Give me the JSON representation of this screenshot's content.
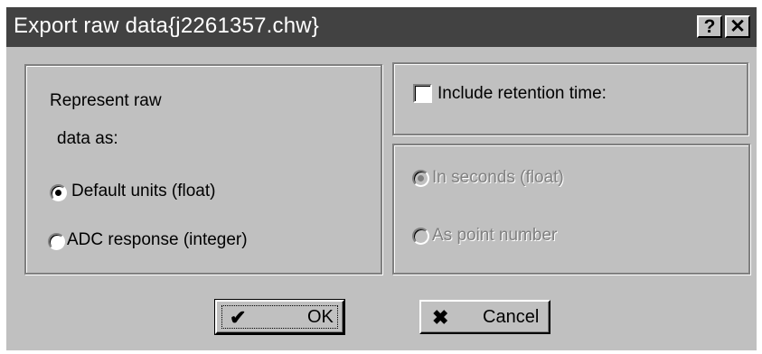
{
  "dialog": {
    "title": "Export raw data{j2261357.chw}",
    "help_button": "?",
    "close_button": "✕"
  },
  "represent": {
    "label_line1": "Represent raw",
    "label_line2": "data as:",
    "options": [
      {
        "label": "Default units (float)",
        "checked": true
      },
      {
        "label": "ADC response (integer)",
        "checked": false
      }
    ]
  },
  "retention": {
    "checkbox_label": "Include retention time:",
    "checked": false,
    "options": [
      {
        "label": "In seconds (float)",
        "checked": true,
        "enabled": false
      },
      {
        "label": "As point number",
        "checked": false,
        "enabled": false
      }
    ]
  },
  "buttons": {
    "ok_label": "OK",
    "ok_icon": "checkmark-icon",
    "cancel_label": "Cancel",
    "cancel_icon": "x-icon"
  }
}
